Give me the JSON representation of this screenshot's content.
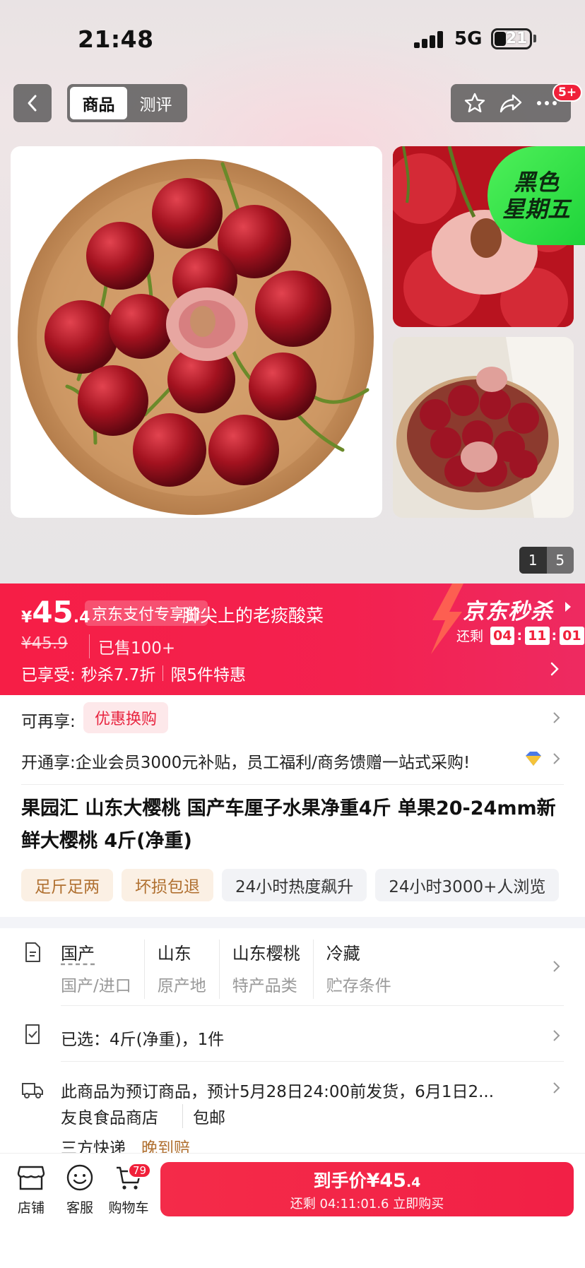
{
  "status_bar": {
    "time": "21:48",
    "network": "5G",
    "battery": "21"
  },
  "nav": {
    "tabs": [
      "商品",
      "测评"
    ],
    "more_badge": "5+"
  },
  "gallery": {
    "badge_line1": "黑色",
    "badge_line2": "星期五",
    "pager_current": "1",
    "pager_total": "5"
  },
  "price_banner": {
    "currency": "¥",
    "price_int": "45",
    "price_dec": ".4",
    "pay_tag": "京东支付专享价",
    "shop_name_overlay": "脚尖上的老痰酸菜",
    "original_price": "¥45.9",
    "sold": "已售100+",
    "enjoyed_label": "已享受:",
    "enjoyed_items": [
      "秒杀7.7折",
      "限5件特惠"
    ],
    "flash_title": "京东秒杀",
    "remain_label": "还剩",
    "countdown": [
      "04",
      "11",
      "01"
    ]
  },
  "offers": {
    "more_label": "可再享:",
    "promo_tag": "优惠换购",
    "membership_text": "开通享:企业会员3000元补贴，员工福利/商务馈赠一站式采购!"
  },
  "product": {
    "title": "果园汇 山东大樱桃 国产车厘子水果净重4斤 单果20-24mm新鲜大樱桃 4斤(净重)",
    "tags": [
      "足斤足两",
      "坏损包退",
      "24小时热度飙升",
      "24小时3000+人浏览"
    ]
  },
  "specs": [
    {
      "value": "国产",
      "key": "国产/进口"
    },
    {
      "value": "山东",
      "key": "原产地"
    },
    {
      "value": "山东樱桃",
      "key": "特产品类"
    },
    {
      "value": "冷藏",
      "key": "贮存条件"
    }
  ],
  "selected": "已选：4斤(净重)，1件",
  "shipping": {
    "notice": "此商品为预订商品，预计5月28日24:00前发货，6月1日2...",
    "shop": "友良食品商店",
    "free_shipping": "包邮",
    "courier": "三方快递",
    "late_compensation": "晚到赔"
  },
  "bottom_bar": {
    "store_label": "店铺",
    "service_label": "客服",
    "cart_label": "购物车",
    "cart_badge": "79",
    "buy_prefix": "到手价",
    "buy_price_int": "¥45",
    "buy_price_dec": ".4",
    "buy_sub": "还剩 04:11:01.6 立即购买"
  },
  "colors": {
    "accent": "#f0203a",
    "flash_green": "#3de84e",
    "tag_warm": "#b07030"
  }
}
